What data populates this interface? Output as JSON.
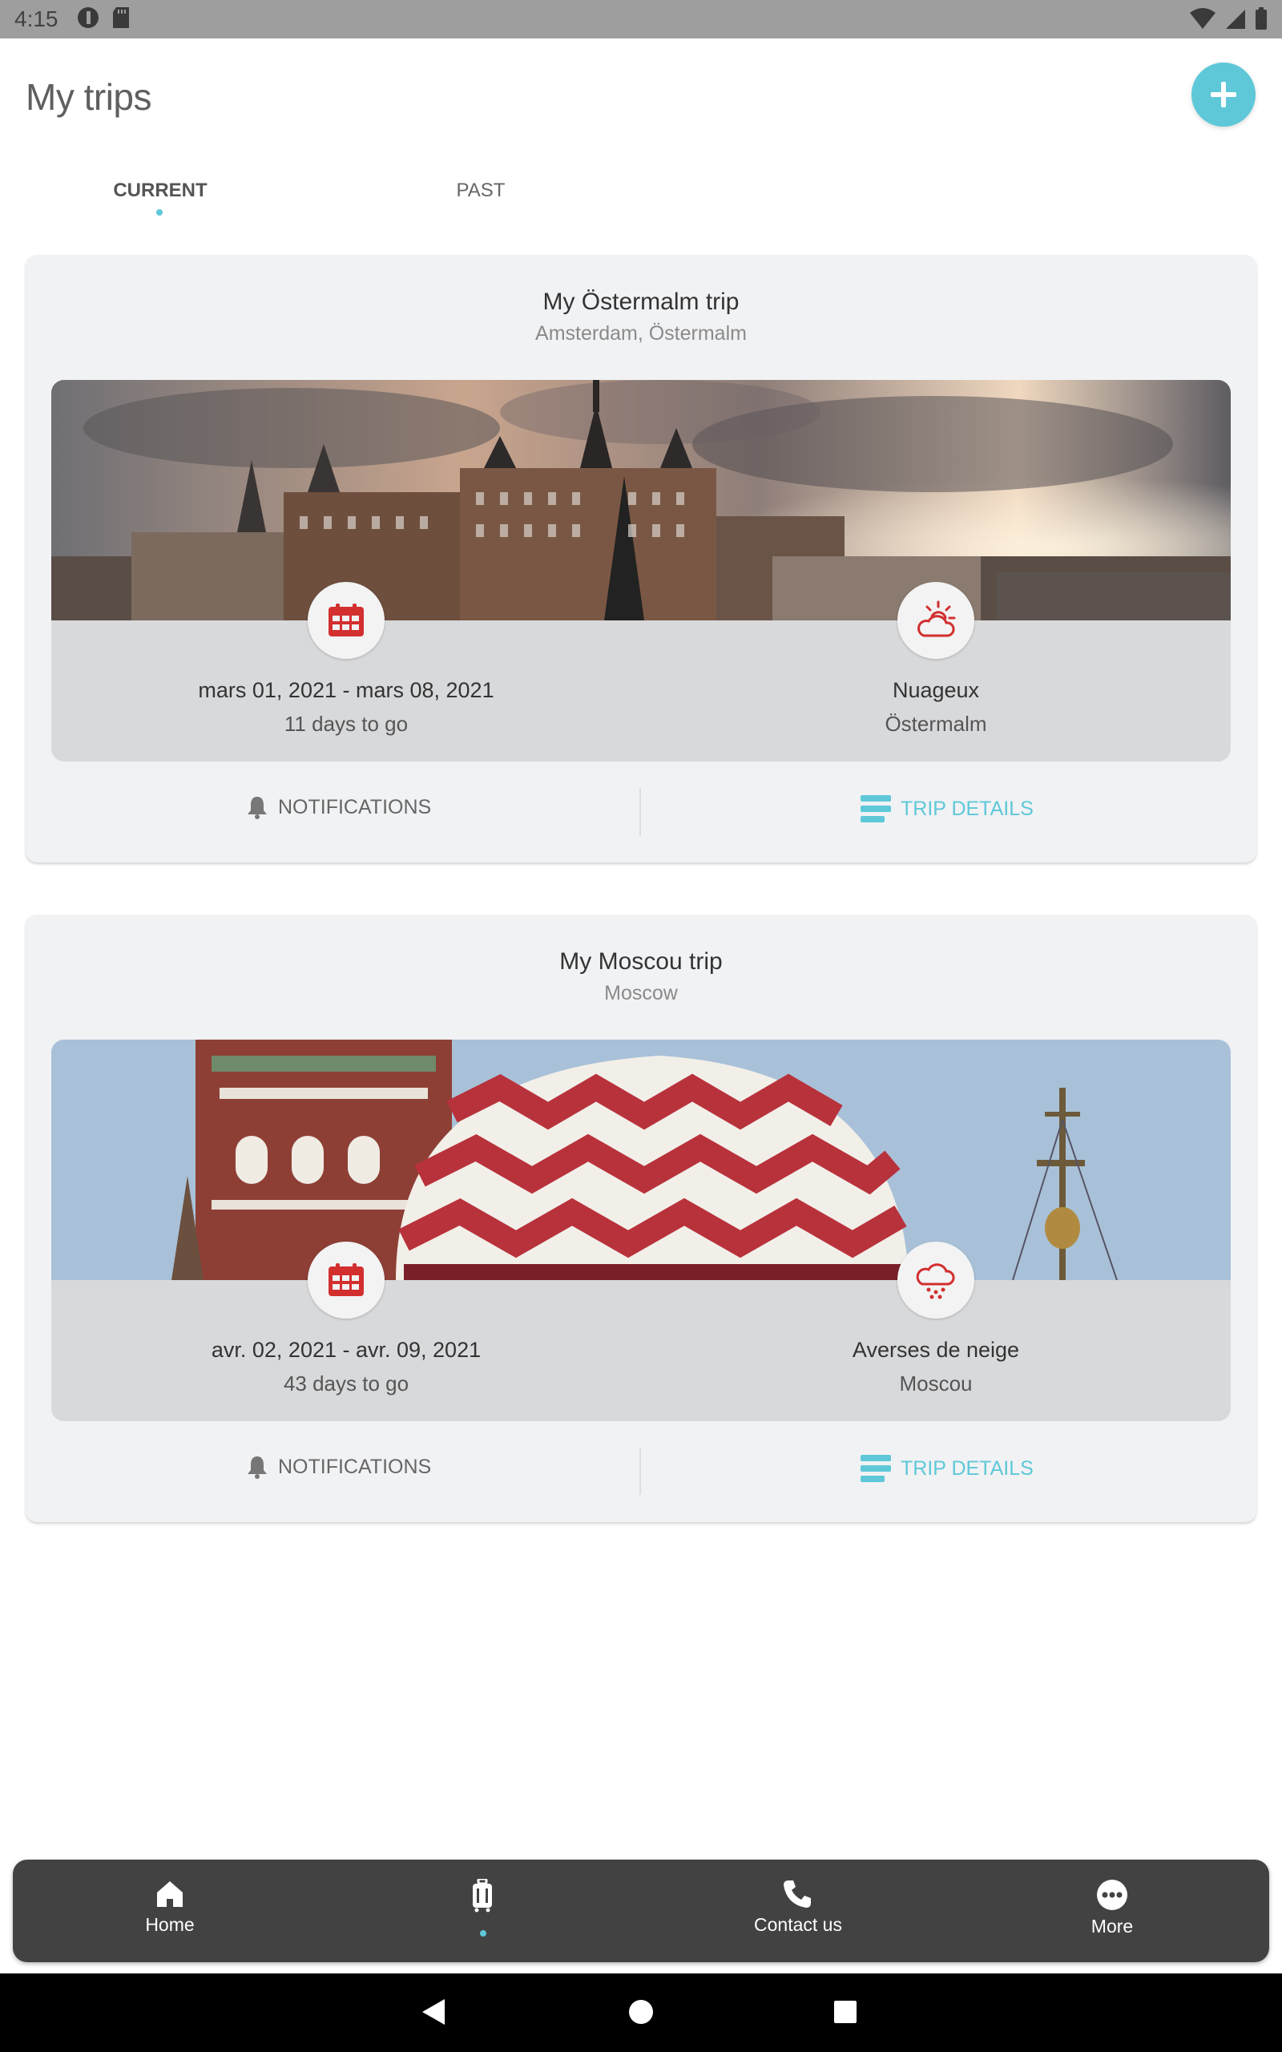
{
  "status_bar": {
    "time": "4:15"
  },
  "header": {
    "title": "My trips",
    "add_button_icon": "plus-icon"
  },
  "tabs": [
    {
      "label": "CURRENT",
      "active": true
    },
    {
      "label": "PAST",
      "active": false
    }
  ],
  "trips": [
    {
      "title": "My Östermalm trip",
      "location": "Amsterdam, Östermalm",
      "dates": "mars 01, 2021 - mars 08, 2021",
      "countdown": "11 days to go",
      "weather": "Nuageux",
      "weather_place": "Östermalm",
      "weather_icon": "partly-cloudy-icon",
      "notifications_label": "NOTIFICATIONS",
      "details_label": "TRIP DETAILS"
    },
    {
      "title": "My Moscou trip",
      "location": "Moscow",
      "dates": "avr. 02, 2021 - avr. 09, 2021",
      "countdown": "43 days to go",
      "weather": "Averses de neige",
      "weather_place": "Moscou",
      "weather_icon": "snow-showers-icon",
      "notifications_label": "NOTIFICATIONS",
      "details_label": "TRIP DETAILS"
    }
  ],
  "bottom_nav": [
    {
      "label": "Home",
      "icon": "home-icon"
    },
    {
      "label": "",
      "icon": "luggage-icon",
      "active": true
    },
    {
      "label": "Contact us",
      "icon": "phone-icon"
    },
    {
      "label": "More",
      "icon": "more-icon"
    }
  ],
  "colors": {
    "accent": "#5ec8d8",
    "badge_red": "#d32f2f",
    "nav_bg": "#424242"
  }
}
